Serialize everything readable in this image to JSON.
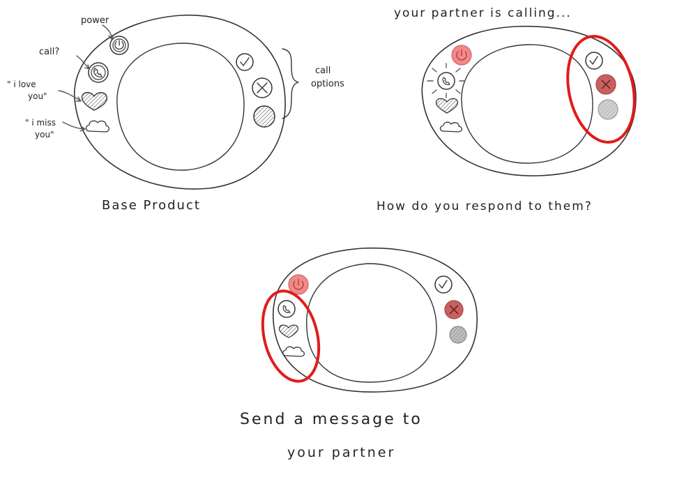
{
  "base": {
    "caption": "Base Product",
    "labels": {
      "power": "power",
      "call": "call?",
      "love_1": "\" i love",
      "love_2": "you\"",
      "miss_1": "\" i miss",
      "miss_2": "you\"",
      "options_1": "call",
      "options_2": "options"
    }
  },
  "calling": {
    "header": "your partner is calling...",
    "caption": "How do you respond to them?"
  },
  "message": {
    "caption_1": "Send a message to",
    "caption_2": "your partner"
  },
  "colors": {
    "highlight_ring": "#e21b1b",
    "active_power": "#f08a8a",
    "active_decline": "#c96060",
    "gray_button": "#cfcfcf"
  }
}
